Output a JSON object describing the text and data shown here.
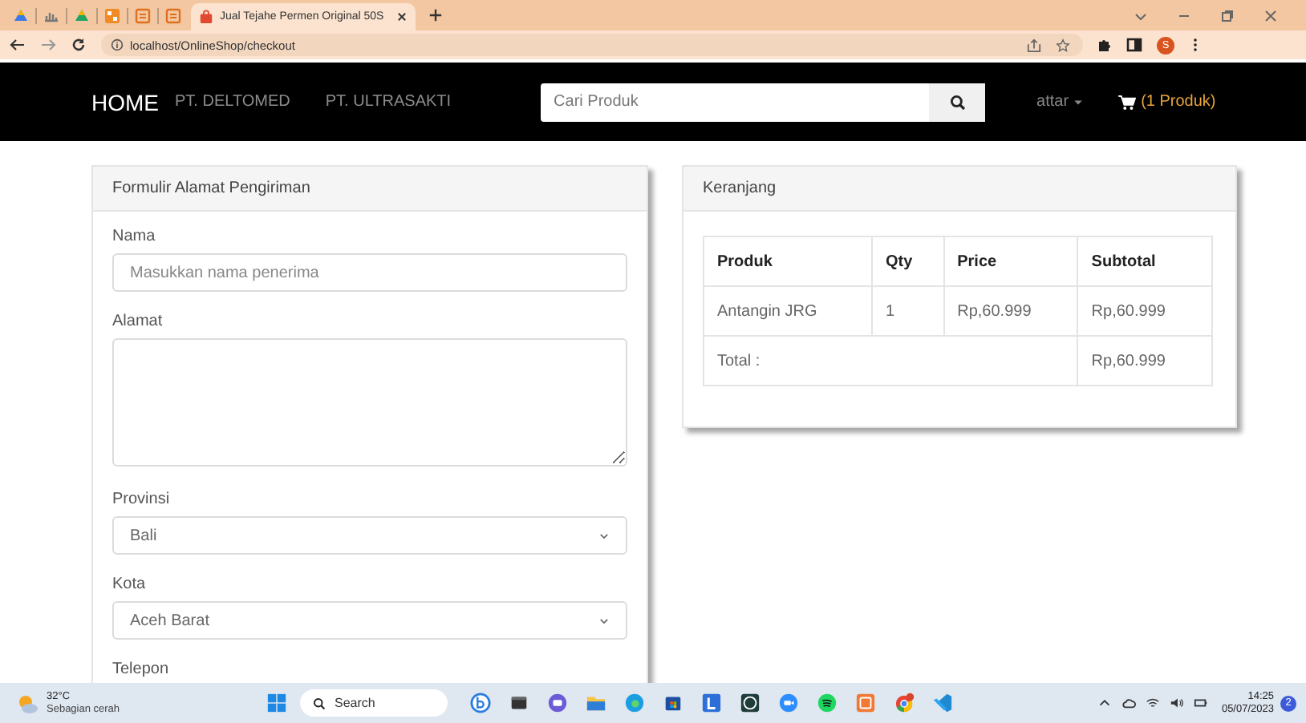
{
  "browser": {
    "tabs": [
      {
        "title": "Jual Tejahe Permen Original 50S",
        "selected": true
      }
    ],
    "address": "localhost/OnlineShop/checkout",
    "profile_initial": "S"
  },
  "navbar": {
    "brand": "HOME",
    "links": [
      "PT. DELTOMED",
      "PT. ULTRASAKTI"
    ],
    "search": {
      "placeholder": "Cari Produk"
    },
    "user": "attar",
    "cart": "(1 Produk)"
  },
  "form": {
    "title": "Formulir Alamat Pengiriman",
    "fields": [
      {
        "kind": "text",
        "label": "Nama",
        "placeholder": "Masukkan nama penerima"
      },
      {
        "kind": "textarea",
        "label": "Alamat"
      },
      {
        "kind": "select",
        "label": "Provinsi",
        "value": "Bali"
      },
      {
        "kind": "select",
        "label": "Kota",
        "value": "Aceh Barat"
      },
      {
        "kind": "label",
        "label": "Telepon"
      }
    ]
  },
  "cart": {
    "title": "Keranjang",
    "columns": [
      "Produk",
      "Qty",
      "Price",
      "Subtotal"
    ],
    "rows": [
      [
        "Antangin JRG",
        "1",
        "Rp,60.999",
        "Rp,60.999"
      ]
    ],
    "total": {
      "label": "Total :",
      "value": "Rp,60.999"
    }
  },
  "taskbar": {
    "temperature": "32°C",
    "weather": "Sebagian cerah",
    "search": "Search",
    "time": "14:25",
    "date": "05/07/2023",
    "notifications": "2"
  }
}
